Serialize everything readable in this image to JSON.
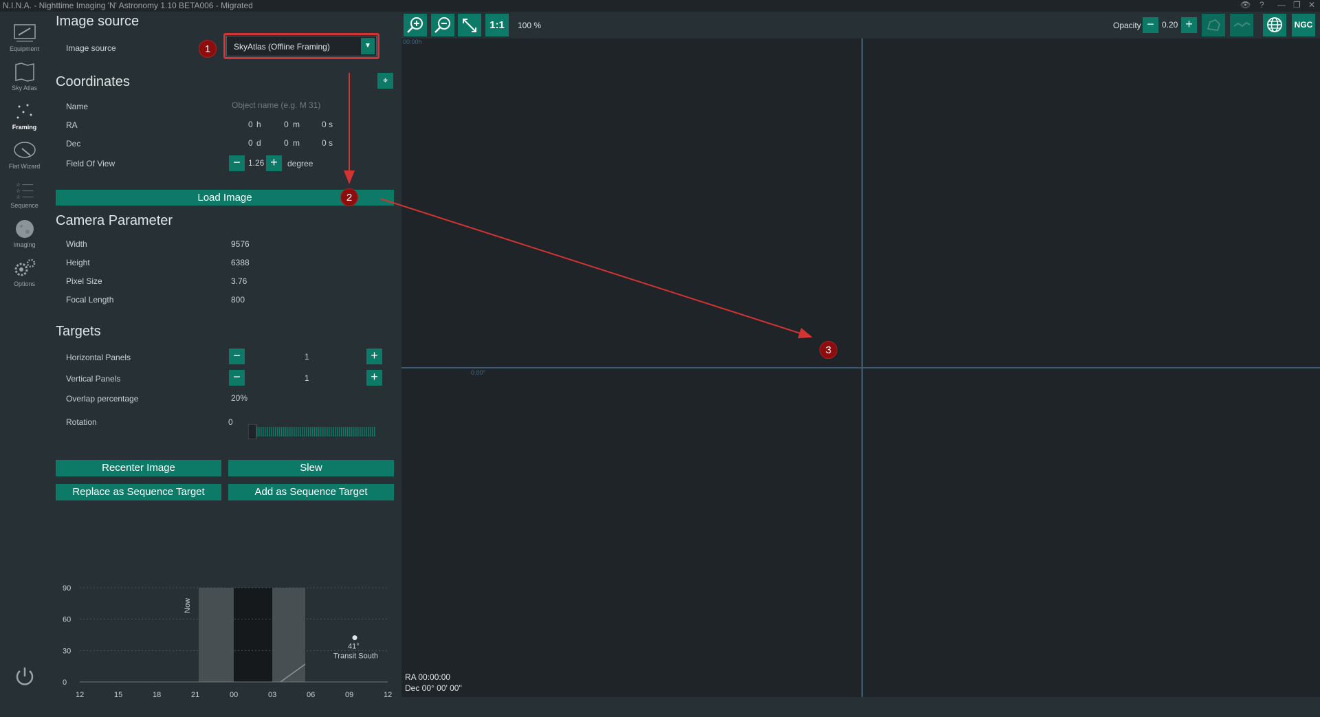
{
  "window": {
    "title": "N.I.N.A. - Nighttime Imaging 'N' Astronomy 1.10 BETA006  -  Migrated"
  },
  "sidebar": {
    "items": [
      {
        "label": "Equipment"
      },
      {
        "label": "Sky Atlas"
      },
      {
        "label": "Framing"
      },
      {
        "label": "Flat Wizard"
      },
      {
        "label": "Sequence"
      },
      {
        "label": "Imaging"
      },
      {
        "label": "Options"
      }
    ]
  },
  "image_source": {
    "heading": "Image source",
    "label": "Image source",
    "selected": "SkyAtlas (Offline Framing)"
  },
  "coordinates": {
    "heading": "Coordinates",
    "name_label": "Name",
    "name_placeholder": "Object name (e.g. M 31)",
    "ra_label": "RA",
    "ra": {
      "h": "0",
      "h_unit": "h",
      "m": "0",
      "m_unit": "m",
      "s": "0",
      "s_unit": "s"
    },
    "dec_label": "Dec",
    "dec": {
      "d": "0",
      "d_unit": "d",
      "m": "0",
      "m_unit": "m",
      "s": "0",
      "s_unit": "s"
    },
    "fov_label": "Field Of View",
    "fov_value": "1.26",
    "fov_unit": "degree"
  },
  "load_button": "Load Image",
  "camera": {
    "heading": "Camera Parameter",
    "rows": [
      {
        "label": "Width",
        "value": "9576"
      },
      {
        "label": "Height",
        "value": "6388"
      },
      {
        "label": "Pixel Size",
        "value": "3.76"
      },
      {
        "label": "Focal Length",
        "value": "800"
      }
    ]
  },
  "targets": {
    "heading": "Targets",
    "horizontal_label": "Horizontal Panels",
    "horizontal_value": "1",
    "vertical_label": "Vertical Panels",
    "vertical_value": "1",
    "overlap_label": "Overlap percentage",
    "overlap_value": "20%",
    "rotation_label": "Rotation",
    "rotation_value": "0"
  },
  "actions": {
    "recenter": "Recenter Image",
    "slew": "Slew",
    "replace": "Replace as Sequence Target",
    "add": "Add as Sequence Target"
  },
  "toolbar": {
    "one_to_one": "1:1",
    "zoom": "100 %",
    "opacity_label": "Opacity",
    "opacity_value": "0.20",
    "ngc": "NGC"
  },
  "canvas": {
    "top_label": "00:00h",
    "mid_label": "0.00°",
    "ra_readout": "RA  00:00:00",
    "dec_readout": "Dec  00° 00' 00\""
  },
  "annotations": {
    "badge1": "1",
    "badge2": "2",
    "badge3": "3",
    "accent": "#d33333"
  },
  "chart_data": {
    "type": "line",
    "title": "",
    "xlabel": "",
    "ylabel": "",
    "x_ticks": [
      "12",
      "15",
      "18",
      "21",
      "00",
      "03",
      "06",
      "09",
      "12"
    ],
    "y_ticks": [
      "90",
      "60",
      "30",
      "0"
    ],
    "ylim": [
      0,
      90
    ],
    "now_label": "Now",
    "transit_label": "41°",
    "transit_caption": "Transit South",
    "grid": true
  }
}
